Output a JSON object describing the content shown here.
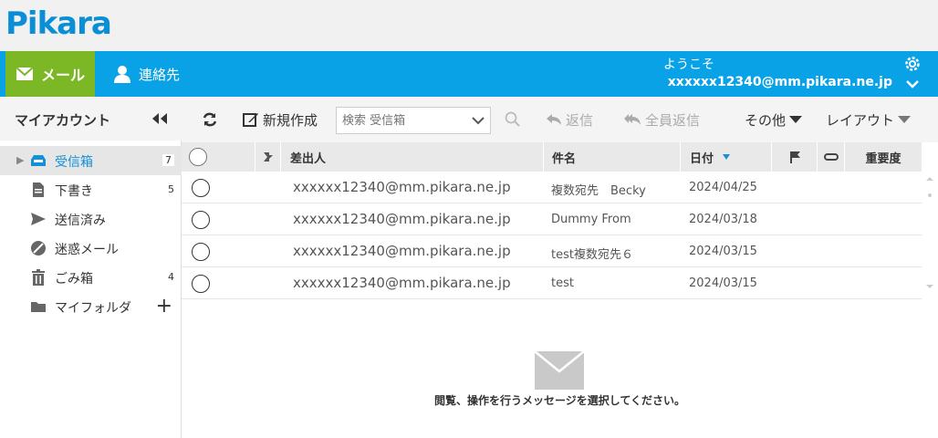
{
  "brand": {
    "logo_text": "Pikara"
  },
  "nav": {
    "mail_label": "メール",
    "contacts_label": "連絡先",
    "welcome": "ようこそ",
    "account_email": "xxxxxx12340@mm.pikara.ne.jp"
  },
  "sidebar": {
    "title": "マイアカウント",
    "folders": [
      {
        "label": "受信箱",
        "count": "7",
        "icon": "inbox-icon",
        "active": true
      },
      {
        "label": "下書き",
        "count": "5",
        "icon": "draft-icon"
      },
      {
        "label": "送信済み",
        "count": "",
        "icon": "sent-icon"
      },
      {
        "label": "迷惑メール",
        "count": "",
        "icon": "spam-icon"
      },
      {
        "label": "ごみ箱",
        "count": "4",
        "icon": "trash-icon"
      },
      {
        "label": "マイフォルダ",
        "count": "",
        "icon": "folder-icon"
      }
    ],
    "add_folder": "+"
  },
  "toolbar": {
    "new_label": "新規作成",
    "search_placeholder": "検索 受信箱",
    "reply_label": "返信",
    "reply_all_label": "全員返信",
    "more_label": "その他",
    "layout_label": "レイアウト"
  },
  "list": {
    "columns": {
      "from": "差出人",
      "subject": "件名",
      "date": "日付",
      "importance": "重要度"
    },
    "rows": [
      {
        "from": "xxxxxx12340@mm.pikara.ne.jp",
        "subject": "複数宛先　Becky",
        "date": "2024/04/25"
      },
      {
        "from": "xxxxxx12340@mm.pikara.ne.jp",
        "subject": "Dummy From",
        "date": "2024/03/18"
      },
      {
        "from": "xxxxxx12340@mm.pikara.ne.jp",
        "subject": "test複数宛先６",
        "date": "2024/03/15"
      },
      {
        "from": "xxxxxx12340@mm.pikara.ne.jp",
        "subject": "test",
        "date": "2024/03/15"
      }
    ]
  },
  "preview": {
    "empty_message": "閲覧、操作を行うメッセージを選択してください。"
  },
  "colors": {
    "nav_blue": "#0aa2e6",
    "mail_green": "#7cb826",
    "accent_blue": "#1290d8"
  }
}
